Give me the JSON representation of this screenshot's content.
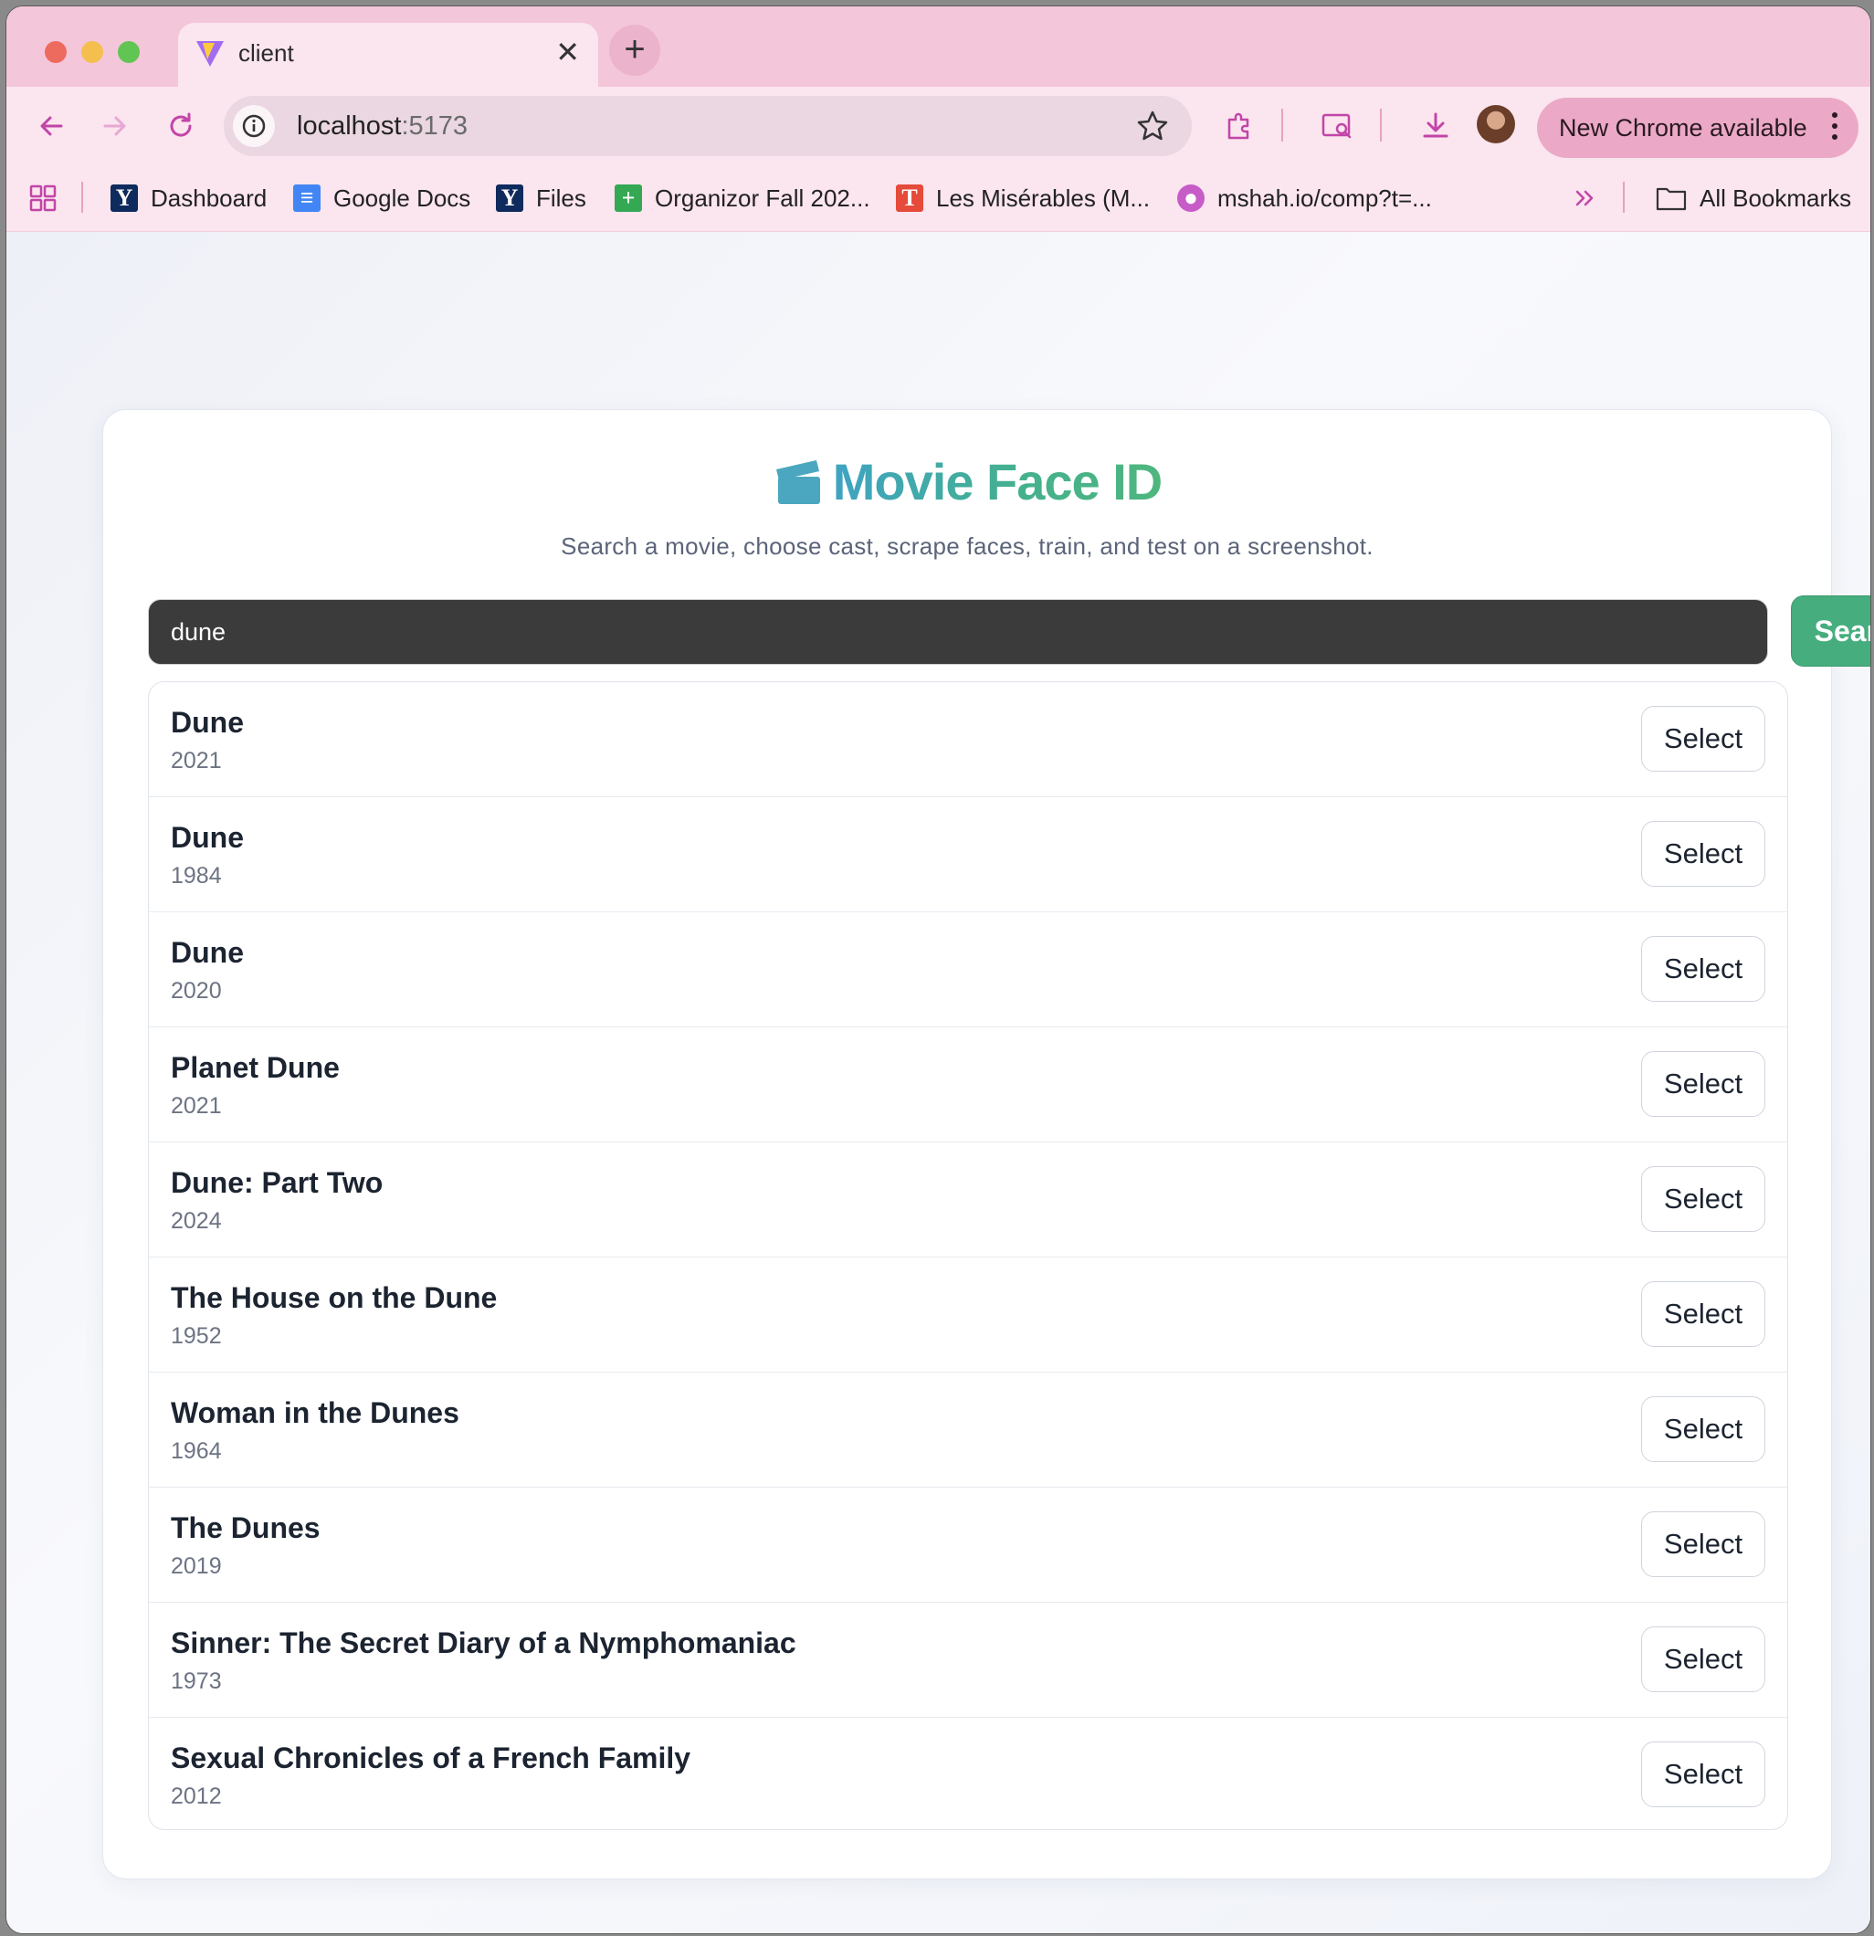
{
  "browser": {
    "tab_title": "client",
    "new_tab_label": "+",
    "close_label": "✕",
    "url_host": "localhost",
    "url_port": ":5173",
    "update_pill": "New Chrome available",
    "bookmarks": [
      {
        "label": "Dashboard",
        "icon": "yale-icon",
        "glyph": "Y"
      },
      {
        "label": "Google Docs",
        "icon": "google-docs-icon",
        "glyph": "≡"
      },
      {
        "label": "Files",
        "icon": "yale-icon",
        "glyph": "Y"
      },
      {
        "label": "Organizor Fall 202...",
        "icon": "google-sheets-icon",
        "glyph": "+"
      },
      {
        "label": "Les Misérables (M...",
        "icon": "les-miserables-icon",
        "glyph": "T"
      },
      {
        "label": "mshah.io/comp?t=...",
        "icon": "globe-icon",
        "glyph": "●"
      }
    ],
    "all_bookmarks": "All Bookmarks"
  },
  "app": {
    "title": "Movie Face ID",
    "subtitle": "Search a movie, choose cast, scrape faces, train, and test on a screenshot.",
    "search_value": "dune",
    "search_button": "Search",
    "select_label": "Select",
    "accent_color": "#46ad7e",
    "results": [
      {
        "title": "Dune",
        "year": "2021"
      },
      {
        "title": "Dune",
        "year": "1984"
      },
      {
        "title": "Dune",
        "year": "2020"
      },
      {
        "title": "Planet Dune",
        "year": "2021"
      },
      {
        "title": "Dune: Part Two",
        "year": "2024"
      },
      {
        "title": "The House on the Dune",
        "year": "1952"
      },
      {
        "title": "Woman in the Dunes",
        "year": "1964"
      },
      {
        "title": "The Dunes",
        "year": "2019"
      },
      {
        "title": "Sinner: The Secret Diary of a Nymphomaniac",
        "year": "1973"
      },
      {
        "title": "Sexual Chronicles of a French Family",
        "year": "2012"
      }
    ]
  }
}
